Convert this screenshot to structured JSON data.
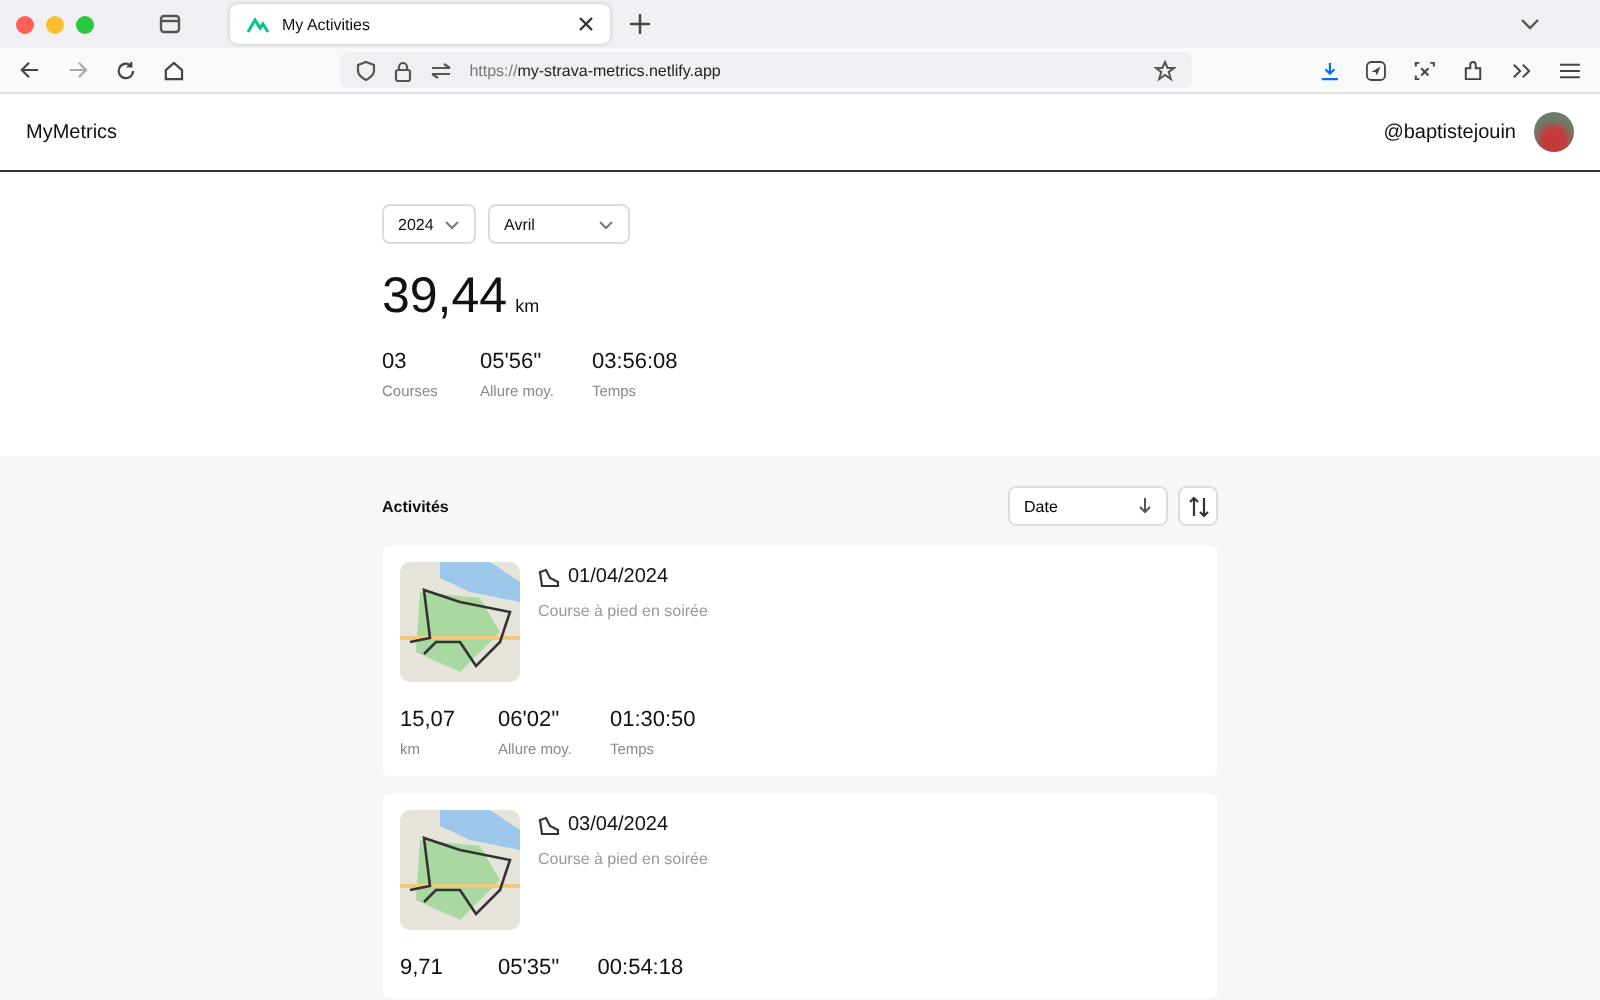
{
  "browser": {
    "tab": {
      "title": "My Activities"
    },
    "url": {
      "scheme": "https://",
      "host": "my-strava-metrics.netlify.app"
    }
  },
  "header": {
    "brand": "MyMetrics",
    "username": "@baptistejouin"
  },
  "filters": {
    "year": "2024",
    "month": "Avril"
  },
  "summary": {
    "distance": "39,44",
    "unit": "km",
    "stats": [
      {
        "value": "03",
        "label": "Courses"
      },
      {
        "value": "05'56''",
        "label": "Allure moy."
      },
      {
        "value": "03:56:08",
        "label": "Temps"
      }
    ]
  },
  "activities": {
    "title": "Activités",
    "sort": "Date",
    "items": [
      {
        "date": "01/04/2024",
        "name": "Course à pied en soirée",
        "stats": [
          {
            "value": "15,07",
            "label": "km"
          },
          {
            "value": "06'02''",
            "label": "Allure moy."
          },
          {
            "value": "01:30:50",
            "label": "Temps"
          }
        ]
      },
      {
        "date": "03/04/2024",
        "name": "Course à pied en soirée",
        "stats": [
          {
            "value": "9,71"
          },
          {
            "value": "05'35''"
          },
          {
            "value": "00:54:18"
          }
        ]
      }
    ]
  }
}
